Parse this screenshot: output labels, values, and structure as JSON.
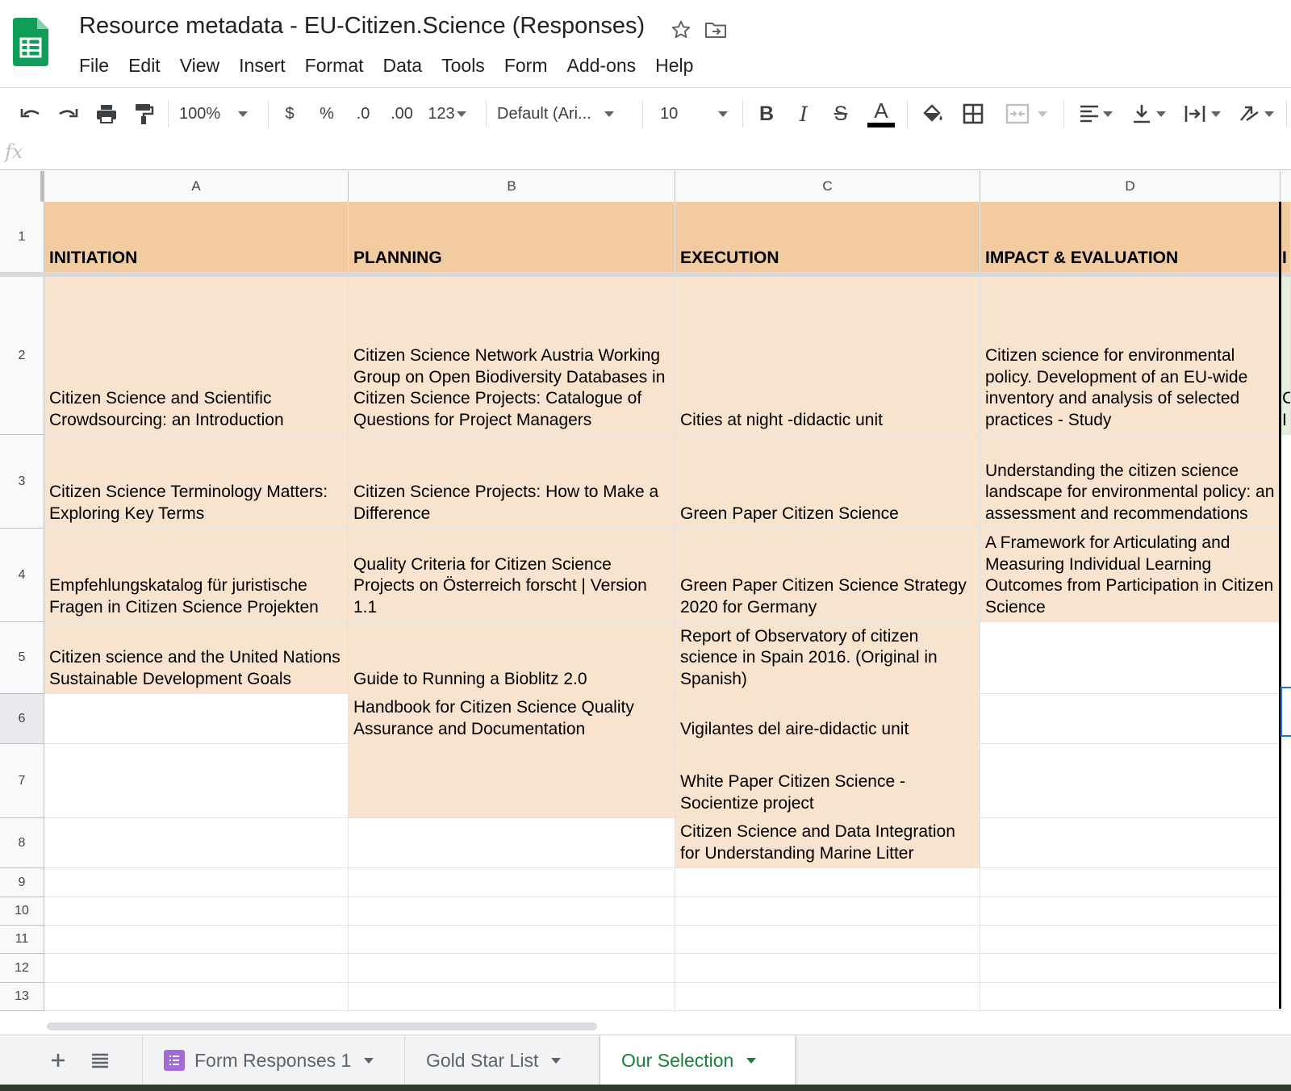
{
  "header": {
    "title": "Resource metadata -  EU-Citizen.Science (Responses)",
    "menu": [
      "File",
      "Edit",
      "View",
      "Insert",
      "Format",
      "Data",
      "Tools",
      "Form",
      "Add-ons",
      "Help"
    ]
  },
  "toolbar": {
    "zoom": "100%",
    "currency": "$",
    "percent": "%",
    "decrease_decimal": ".0",
    "increase_decimal": ".00",
    "more_formats": "123",
    "font": "Default (Ari...",
    "font_size": "10",
    "bold": "B",
    "italic": "I",
    "strike": "S",
    "text_color": "A"
  },
  "formula_bar": {
    "fx": "fx",
    "value": ""
  },
  "grid": {
    "columns": [
      "A",
      "B",
      "C",
      "D"
    ],
    "rows": [
      "1",
      "2",
      "3",
      "4",
      "5",
      "6",
      "7",
      "8",
      "9",
      "10",
      "11",
      "12",
      "13"
    ],
    "cells": {
      "A1": "INITIATION",
      "B1": "PLANNING",
      "C1": "EXECUTION",
      "D1": "IMPACT & EVALUATION",
      "E1": "I",
      "A2": "Citizen Science and Scientific Crowdsourcing: an Introduction",
      "B2": "Citizen Science Network Austria Working Group on Open Biodiversity Databases in Citizen Science Projects: Catalogue of Questions for Project Managers",
      "C2": "Cities at night -didactic unit",
      "D2": "Citizen science for environmental policy. Development of an EU-wide inventory and analysis of selected practices - Study",
      "E2": "C I",
      "A3": "Citizen Science Terminology Matters: Exploring Key Terms",
      "B3": "Citizen Science Projects: How to Make a Difference",
      "C3": "Green Paper Citizen Science",
      "D3": "Understanding the citizen science landscape for environmental policy: an assessment and recommendations",
      "A4": "Empfehlungskatalog für juristische Fragen in Citizen Science Projekten",
      "B4": "Quality Criteria for Citizen Science Projects on Österreich forscht | Version 1.1",
      "C4": "Green Paper Citizen Science Strategy 2020 for Germany",
      "D4": "A Framework for Articulating and Measuring Individual Learning Outcomes from Participation in Citizen Science",
      "A5": "Citizen science and the United Nations Sustainable Development Goals",
      "B5": "Guide to Running a Bioblitz 2.0",
      "C5": "Report of Observatory of citizen science in Spain 2016. (Original in Spanish)",
      "B6": "Handbook for Citizen Science Quality Assurance and Documentation",
      "C6": "Vigilantes del aire-didactic unit",
      "C7": "White Paper Citizen Science -Socientize project",
      "C8": "Citizen Science and Data Integration for Understanding Marine Litter"
    }
  },
  "sheets": [
    {
      "name": "Form Responses 1",
      "active": false,
      "icon": "form-icon"
    },
    {
      "name": "Gold Star List",
      "active": false
    },
    {
      "name": "Our Selection",
      "active": true
    }
  ],
  "colors": {
    "header_fill": "#f2cba0",
    "cell_fill": "#f8e3cf",
    "active_tab": "#188038",
    "sheets_green": "#0f9d58"
  }
}
